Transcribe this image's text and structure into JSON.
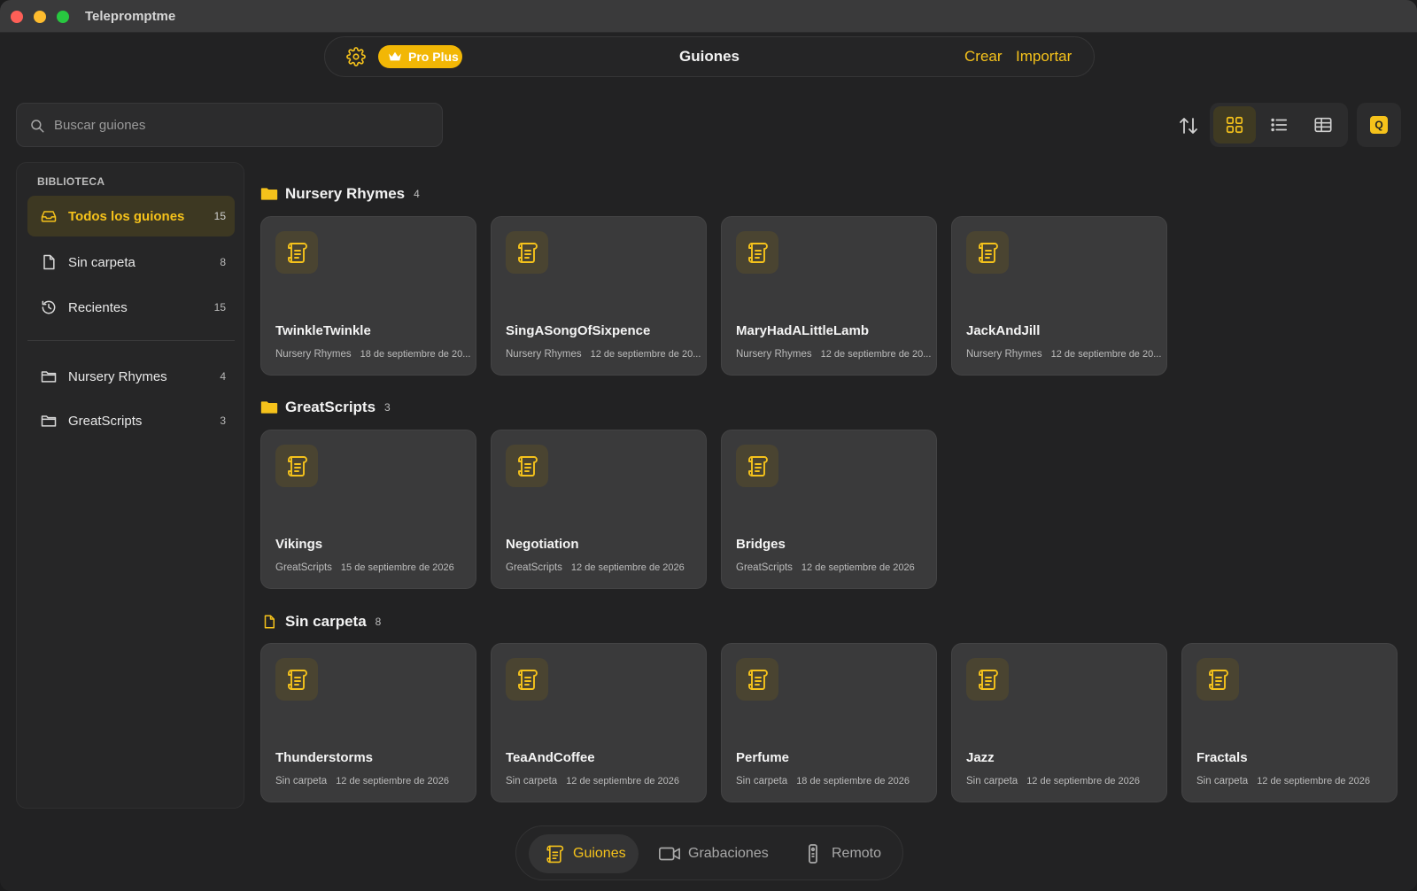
{
  "app": {
    "title": "Telepromptme"
  },
  "topbar": {
    "settings_icon": "gear-icon",
    "badge": "Pro Plus",
    "title": "Guiones",
    "crear": "Crear",
    "importar": "Importar"
  },
  "search": {
    "placeholder": "Buscar guiones",
    "value": ""
  },
  "toolbar": {
    "sort_icon": "sort-arrows-icon",
    "views": [
      "grid-view-icon",
      "list-view-icon",
      "table-view-icon"
    ],
    "active_view": "grid",
    "q_label": "Q"
  },
  "sidebar": {
    "heading": "BIBLIOTECA",
    "items": [
      {
        "label": "Todos los guiones",
        "count": "15",
        "icon": "tray-icon",
        "active": true
      },
      {
        "label": "Sin carpeta",
        "count": "8",
        "icon": "document-icon"
      },
      {
        "label": "Recientes",
        "count": "15",
        "icon": "history-icon"
      }
    ],
    "folders": [
      {
        "label": "Nursery Rhymes",
        "count": "4",
        "icon": "folder-icon"
      },
      {
        "label": "GreatScripts",
        "count": "3",
        "icon": "folder-icon"
      }
    ]
  },
  "sections": [
    {
      "title": "Nursery Rhymes",
      "count": "4",
      "icon": "folder-filled-icon",
      "cards": [
        {
          "title": "TwinkleTwinkle",
          "folder": "Nursery Rhymes",
          "date": "18 de septiembre de 20..."
        },
        {
          "title": "SingASongOfSixpence",
          "folder": "Nursery Rhymes",
          "date": "12 de septiembre de 20..."
        },
        {
          "title": "MaryHadALittleLamb",
          "folder": "Nursery Rhymes",
          "date": "12 de septiembre de 20..."
        },
        {
          "title": "JackAndJill",
          "folder": "Nursery Rhymes",
          "date": "12 de septiembre de 20..."
        }
      ]
    },
    {
      "title": "GreatScripts",
      "count": "3",
      "icon": "folder-filled-icon",
      "cards": [
        {
          "title": "Vikings",
          "folder": "GreatScripts",
          "date": "15 de septiembre de 2026"
        },
        {
          "title": "Negotiation",
          "folder": "GreatScripts",
          "date": "12 de septiembre de 2026"
        },
        {
          "title": "Bridges",
          "folder": "GreatScripts",
          "date": "12 de septiembre de 2026"
        }
      ]
    },
    {
      "title": "Sin carpeta",
      "count": "8",
      "icon": "document-icon",
      "cards": [
        {
          "title": "Thunderstorms",
          "folder": "Sin carpeta",
          "date": "12 de septiembre de 2026"
        },
        {
          "title": "TeaAndCoffee",
          "folder": "Sin carpeta",
          "date": "12 de septiembre de 2026"
        },
        {
          "title": "Perfume",
          "folder": "Sin carpeta",
          "date": "18 de septiembre de 2026"
        },
        {
          "title": "Jazz",
          "folder": "Sin carpeta",
          "date": "12 de septiembre de 2026"
        },
        {
          "title": "Fractals",
          "folder": "Sin carpeta",
          "date": "12 de septiembre de 2026"
        }
      ]
    }
  ],
  "tabbar": {
    "tabs": [
      {
        "label": "Guiones",
        "icon": "script-icon",
        "active": true
      },
      {
        "label": "Grabaciones",
        "icon": "video-camera-icon"
      },
      {
        "label": "Remoto",
        "icon": "remote-icon"
      }
    ]
  },
  "colors": {
    "accent": "#f5c21b",
    "badge": "#f2b705",
    "background": "#222223",
    "card": "#3a3a3b"
  }
}
